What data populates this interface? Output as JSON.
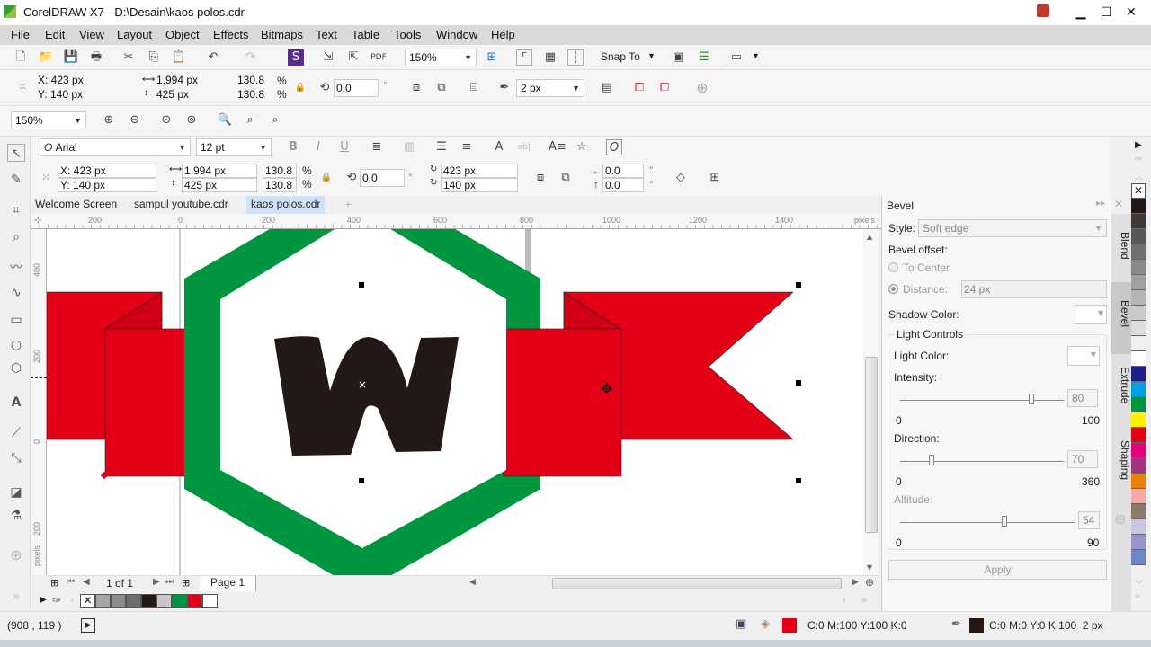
{
  "window": {
    "title": "CorelDRAW X7 - D:\\Desain\\kaos polos.cdr",
    "minimize": "▁",
    "maximize": "☐",
    "close": "✕"
  },
  "menu": [
    "File",
    "Edit",
    "View",
    "Layout",
    "Object",
    "Effects",
    "Bitmaps",
    "Text",
    "Table",
    "Tools",
    "Window",
    "Help"
  ],
  "standard_toolbar": {
    "zoom_level": "150%",
    "snap_to": "Snap To"
  },
  "property_bar": {
    "x": "X: 423 px",
    "y": "Y: 140 px",
    "width": "1,994 px",
    "height": "425 px",
    "scale_w": "130.8",
    "scale_h": "130.8",
    "pct": "%",
    "rotation": "0.0",
    "degree": "°",
    "outline_width": "2 px"
  },
  "zoom_toolbar": {
    "zoom_level": "150%"
  },
  "text_bar": {
    "font": "Arial",
    "size": "12 pt"
  },
  "property_bar2": {
    "x": "X: 423 px",
    "y": "Y: 140 px",
    "width": "1,994 px",
    "height": "425 px",
    "scale_w": "130.8",
    "scale_h": "130.8",
    "rotation": "0.0",
    "center_x": "423 px",
    "center_y": "140 px",
    "skew_h": "0.0",
    "skew_v": "0.0"
  },
  "doc_tabs": [
    {
      "label": "Welcome Screen",
      "active": false
    },
    {
      "label": "sampul youtube.cdr",
      "active": false
    },
    {
      "label": "kaos polos.cdr",
      "active": true
    }
  ],
  "ruler": {
    "top": [
      "200",
      "0",
      "200",
      "400",
      "600",
      "800",
      "1000",
      "1200",
      "1400"
    ],
    "unit": "pixels",
    "left": [
      "400",
      "200",
      "0",
      "200"
    ],
    "left_unit": "pixels"
  },
  "artwork": {
    "letter": "W",
    "colors": {
      "red": "#e30016",
      "green": "#00963f",
      "black": "#231815",
      "white": "#ffffff"
    }
  },
  "page_nav": {
    "count": "1 of 1",
    "page_tab": "Page 1"
  },
  "document_palette": [
    "#a6a6a6",
    "#8c8c8c",
    "#6e6e6e",
    "#231815",
    "#c8c8c8",
    "#00963f",
    "#e30016",
    "#ffffff"
  ],
  "status": {
    "coords": "(908 , 119 )",
    "fill": "C:0 M:100 Y:100 K:0",
    "fill_color": "#e30016",
    "outline": "C:0 M:0 Y:0 K:100  2 px",
    "outline_color": "#231815"
  },
  "docker": {
    "title": "Bevel",
    "style_label": "Style:",
    "style_value": "Soft edge",
    "bevel_offset": "Bevel offset:",
    "to_center": "To Center",
    "distance_label": "Distance:",
    "distance_value": "24 px",
    "shadow_color": "Shadow Color:",
    "light_controls": "Light Controls",
    "light_color": "Light Color:",
    "intensity": {
      "label": "Intensity:",
      "value": "80",
      "min": "0",
      "max": "100",
      "fraction": 0.8
    },
    "direction": {
      "label": "Direction:",
      "value": "70",
      "min": "0",
      "max": "360",
      "fraction": 0.194
    },
    "altitude": {
      "label": "Altitude:",
      "value": "54",
      "min": "0",
      "max": "90",
      "fraction": 0.6
    },
    "apply": "Apply"
  },
  "docker_tabs": [
    "Blend",
    "Bevel",
    "Extrude",
    "Shaping"
  ],
  "color_palette": [
    "#231815",
    "#3e3a39",
    "#595757",
    "#727171",
    "#898989",
    "#9fa0a0",
    "#b5b5b6",
    "#c9caca",
    "#dcdddd",
    "#efefef",
    "#ffffff",
    "#1d2088",
    "#00a0e9",
    "#00963f",
    "#fff100",
    "#e60012",
    "#e4007f",
    "#a4327c",
    "#eb8100",
    "#f3a9a8",
    "#8c7b6c",
    "#c9c6e2",
    "#9896c8",
    "#6e86c4"
  ]
}
